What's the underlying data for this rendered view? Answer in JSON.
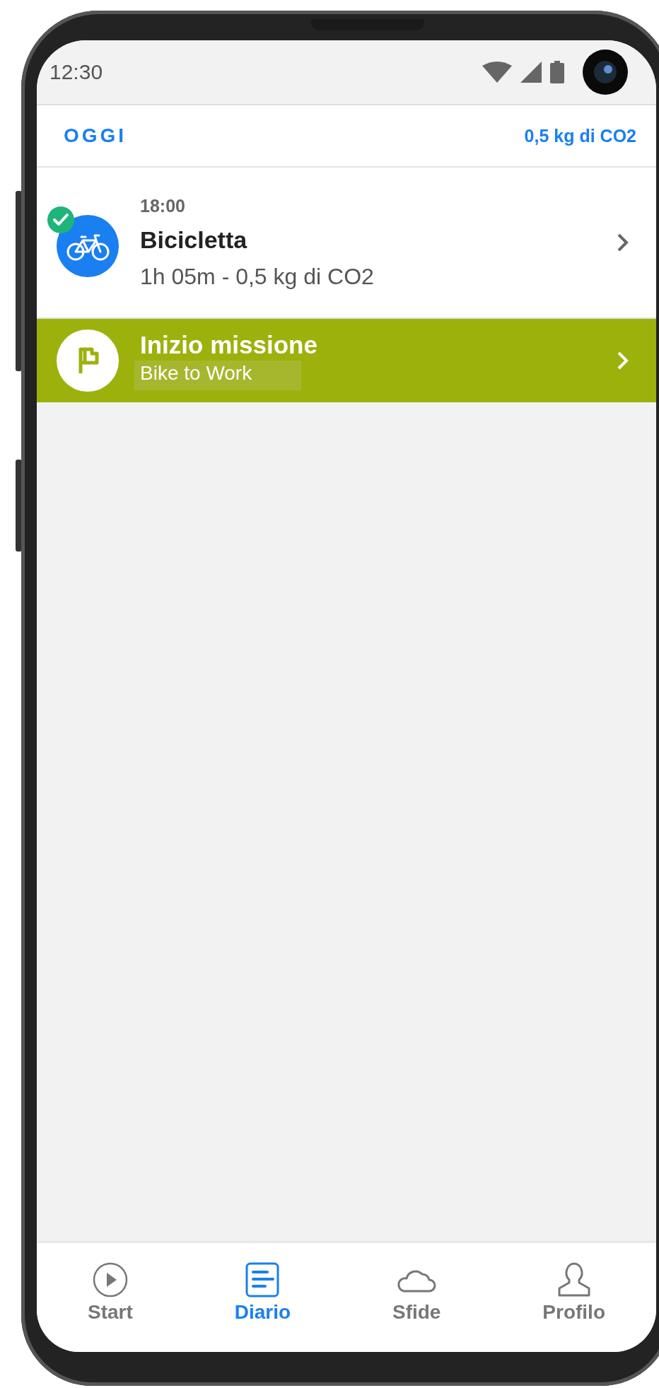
{
  "status_bar": {
    "time": "12:30"
  },
  "header": {
    "title": "OGGI",
    "total": "0,5 kg di CO2"
  },
  "entries": [
    {
      "kind": "trip",
      "time": "18:00",
      "title": "Bicicletta",
      "detail": "1h 05m - 0,5 kg di CO2",
      "completed": true
    },
    {
      "kind": "mission",
      "title": "Inizio missione",
      "subtitle": "Bike to Work"
    }
  ],
  "nav": [
    {
      "label": "Start",
      "selected": false
    },
    {
      "label": "Diario",
      "selected": true
    },
    {
      "label": "Sfide",
      "selected": false
    },
    {
      "label": "Profilo",
      "selected": false
    }
  ]
}
